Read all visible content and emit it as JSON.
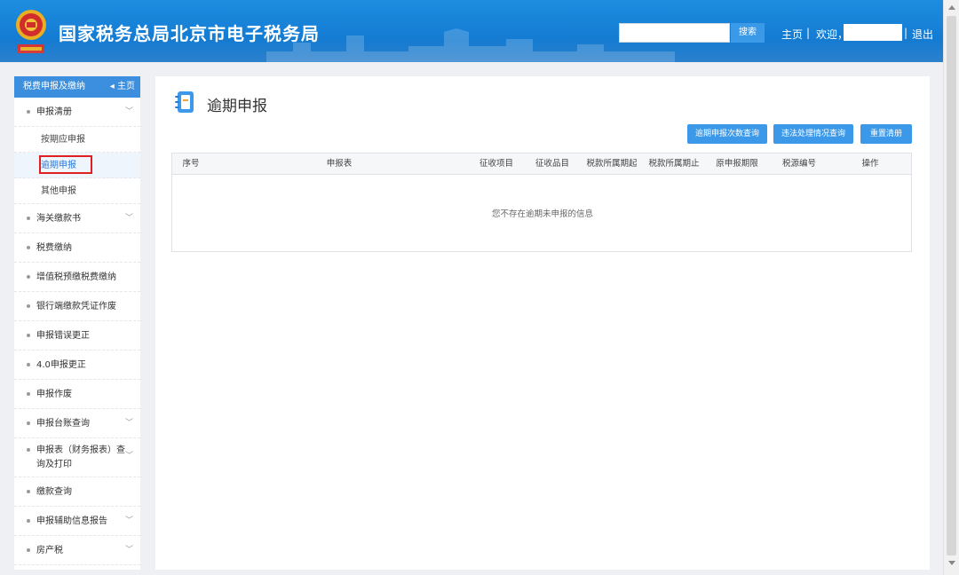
{
  "header": {
    "title": "国家税务总局北京市电子税务局",
    "emblem_icon": "tax-emblem-icon",
    "search_placeholder": "",
    "search_label": "搜索",
    "home_label": "主页",
    "separator": "|",
    "welcome_label": "欢迎，",
    "logout_label": "退出",
    "bg_color": "#157ed4"
  },
  "sidebar": {
    "title": "税费申报及缴纳",
    "home_link": "主页",
    "home_icon": "back-arrow-icon",
    "items": [
      {
        "label": "申报清册",
        "expandable": true
      },
      {
        "label": "按期应申报"
      },
      {
        "label": "逾期申报",
        "active": true
      },
      {
        "label": "其他申报"
      },
      {
        "label": "海关缴款书",
        "expandable": true
      },
      {
        "label": "税费缴纳"
      },
      {
        "label": "增值税预缴税费缴纳"
      },
      {
        "label": "银行端缴款凭证作废"
      },
      {
        "label": "申报错误更正"
      },
      {
        "label": "4.0申报更正"
      },
      {
        "label": "申报作废"
      },
      {
        "label": "申报台账查询",
        "expandable": true
      },
      {
        "label": "申报表（财务报表）查询及打印",
        "expandable": true
      },
      {
        "label": "缴款查询"
      },
      {
        "label": "申报辅助信息报告",
        "expandable": true
      },
      {
        "label": "房产税",
        "expandable": true
      }
    ]
  },
  "main": {
    "page_title": "逾期申报",
    "page_icon": "notebook-icon",
    "buttons": [
      "逾期申报次数查询",
      "违法处理情况查询",
      "重置清册"
    ],
    "table": {
      "columns": [
        "序号",
        "申报表",
        "征收项目",
        "征收品目",
        "税款所属期起",
        "税款所属期止",
        "原申报期限",
        "税源编号",
        "操作"
      ],
      "rows": [],
      "empty_message": "您不存在逾期未申报的信息"
    }
  },
  "colors": {
    "accent": "#3c98e8",
    "active_highlight": "#e02020"
  }
}
